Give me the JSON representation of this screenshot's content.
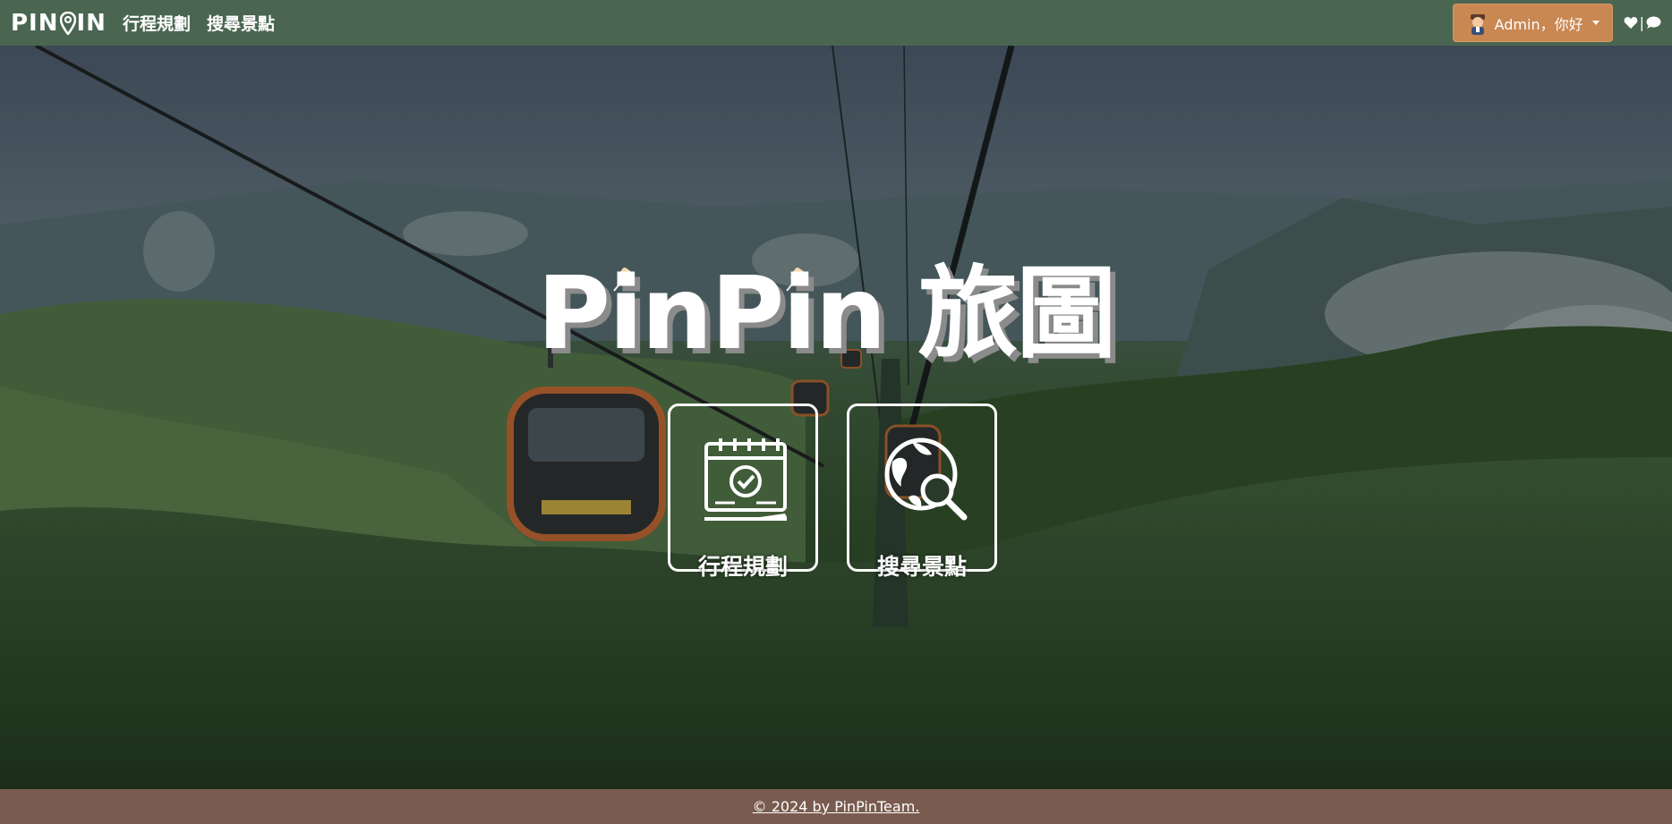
{
  "navbar": {
    "brand": "PIN",
    "brand_suffix": "IN",
    "links": [
      "行程規劃",
      "搜尋景點"
    ],
    "user_label": "Admin，你好",
    "icons": [
      "heart-icon",
      "chat-icon"
    ],
    "colors": {
      "navbar_bg": "#4a6650",
      "user_button_bg": "#c98752"
    }
  },
  "hero": {
    "title": "PinPin 旅圖",
    "tiles": [
      {
        "label": "行程規劃",
        "icon": "calendar-check-icon"
      },
      {
        "label": "搜尋景點",
        "icon": "globe-search-icon"
      }
    ]
  },
  "footer": {
    "text": "© 2024 by PinPinTeam.",
    "bg": "#7a5b50"
  }
}
